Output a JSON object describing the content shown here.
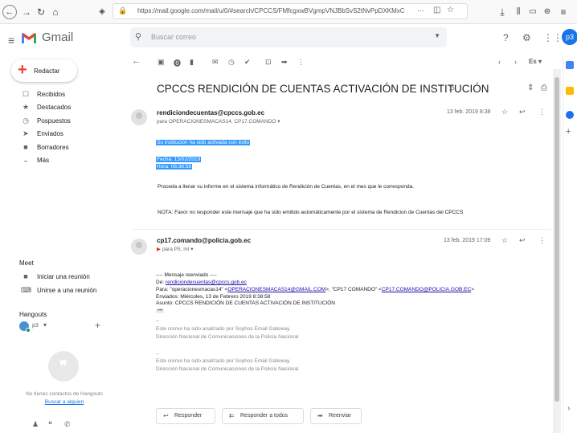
{
  "browser": {
    "back_icon": "arrow-left-icon",
    "url": "https://mail.google.com/mail/u/0/#search/CPCCS/FMfcgxwBVgmpVNJBbSvS2tNvPpDXKMxC",
    "url_more": "···"
  },
  "app": {
    "name": "Gmail",
    "search_placeholder": "Buscar correo",
    "avatar_label": "p3"
  },
  "sidebar": {
    "compose_label": "Redactar",
    "items": [
      {
        "icon": "inbox-icon",
        "glyph": "☐",
        "label": "Recibidos"
      },
      {
        "icon": "star-icon",
        "glyph": "★",
        "label": "Destacados"
      },
      {
        "icon": "clock-icon",
        "glyph": "◷",
        "label": "Pospuestos"
      },
      {
        "icon": "send-icon",
        "glyph": "➤",
        "label": "Enviados"
      },
      {
        "icon": "draft-icon",
        "glyph": "■",
        "label": "Borradores"
      },
      {
        "icon": "chevron-down-icon",
        "glyph": "⌄",
        "label": "Más"
      }
    ],
    "meet_title": "Meet",
    "meet_items": [
      {
        "icon": "video-icon",
        "glyph": "■",
        "label": "Iniciar una reunión"
      },
      {
        "icon": "keyboard-icon",
        "glyph": "⌨",
        "label": "Unirse a una reunión"
      }
    ],
    "hangouts_title": "Hangouts",
    "hangouts_user": "p3",
    "hangouts_none": "No tienes contactos de Hangouts",
    "hangouts_find": "Buscar a alguien"
  },
  "thread": {
    "subject": "CPCCS RENDICIÓN DE CUENTAS ACTIVACIÓN DE INSTITUCIÓN",
    "language": "Es",
    "messages": [
      {
        "sender": "rendiciondecuentas@cpccs.gob.ec",
        "recipients": "para OPERACIONESMACAS14, CP17.COMANDO",
        "date": "13 feb. 2019 8:38",
        "lines": {
          "activated": "Su institución ha sido activada con éxito",
          "fecha": "Fecha:  13/02/2019",
          "hora": "Hora:   08:38:58",
          "proceda": "Proceda a llenar su informe en el sistema informático de Rendición de Cuentas, en el mes que le corresponda.",
          "nota": "NOTA:   Favor no responder este mensaje que ha sido emitido automáticamente por el sistema de Rendicion de Cuentas del CPCCS"
        }
      },
      {
        "sender": "cp17.comando@policia.gob.ec",
        "recipients": "para P5, mí",
        "date": "13 feb. 2019 17:09",
        "lines": {
          "fwd_header": "---- Mensaje reenviado ----",
          "de_label": "De: ",
          "de_value": "rendiciondecuentas@cpccs.gob.ec",
          "para_label": "Para: \"operacionesmacas14\" <",
          "para_value1": "OPERACIONESMACAS14@GMAIL.COM",
          "para_mid": ">, \"CP17 COMANDO\" <",
          "para_value2": "CP17.COMANDO@POLICIA.GOB.EC",
          "para_end": ">",
          "enviados": "Enviados: Miércoles, 13 de Febrero 2019 8:38:58",
          "asunto": "Asunto: CPCCS RENDICIÓN DE CUENTAS ACTIVACIÓN DE INSTITUCIÓN",
          "dots": "•••",
          "dash1": "--",
          "sophos1": "Este correo ha sido analizado por Sophos Email Gateway.",
          "direccion1": "Dirección Nacional de Comunicaciones de la Policía Nacional",
          "dash2": "--",
          "sophos2": "Este correo ha sido analizado por Sophos Email Gateway.",
          "direccion2": "Dirección Nacional de Comunicaciones de la Policía Nacional"
        }
      }
    ],
    "reply_buttons": {
      "reply": "Responder",
      "reply_all": "Responder a todos",
      "forward": "Reenviar"
    }
  },
  "colors": {
    "gmail_red": "#ea4335",
    "highlight": "#3399ff",
    "link": "#1a0dab",
    "accent": "#1a73e8"
  }
}
